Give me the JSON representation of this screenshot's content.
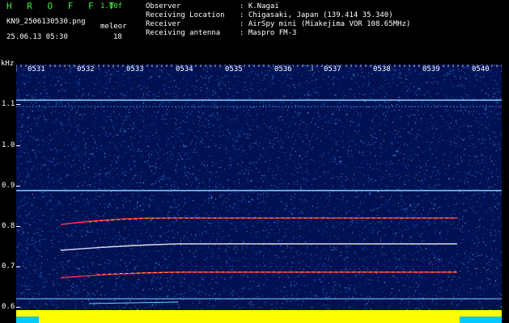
{
  "header": {
    "brand": "H R O F F T",
    "version": "1.00f",
    "filename": "KN9_2506130530.png",
    "meteor_label": "meleor",
    "timestamp": "25.06.13 05:30",
    "meteor_count": "18"
  },
  "info": {
    "rows": [
      {
        "label": "Observer",
        "value": ": K.Nagai"
      },
      {
        "label": "Receiving Location",
        "value": ": Chigasaki, Japan (139.414 35.340)"
      },
      {
        "label": "Receiver",
        "value": ": AirSpy mini (Miakejima VOR 108.65MHz)"
      },
      {
        "label": "Receiving antenna",
        "value": ": Maspro FM-3"
      }
    ]
  },
  "axis": {
    "unit": "kHz",
    "time_labels": [
      "0531",
      "0532",
      "0533",
      "0534",
      "0535",
      "0536",
      "0537",
      "0538",
      "0539",
      "0540"
    ],
    "freq_labels": [
      "1.1",
      "1.0",
      "0.9",
      "0.8",
      "0.7",
      "0.6"
    ]
  },
  "colors": {
    "background": "#000000",
    "plot_noise": "#00155a",
    "brand_green": "#3cf23c",
    "carrier_line": "#7fd4ff",
    "signal_red": "#ff2a4a",
    "signal_yellow": "#f3e02c",
    "bottom_yellow": "#ffff00",
    "bottom_cyan": "#00c8ff"
  }
}
